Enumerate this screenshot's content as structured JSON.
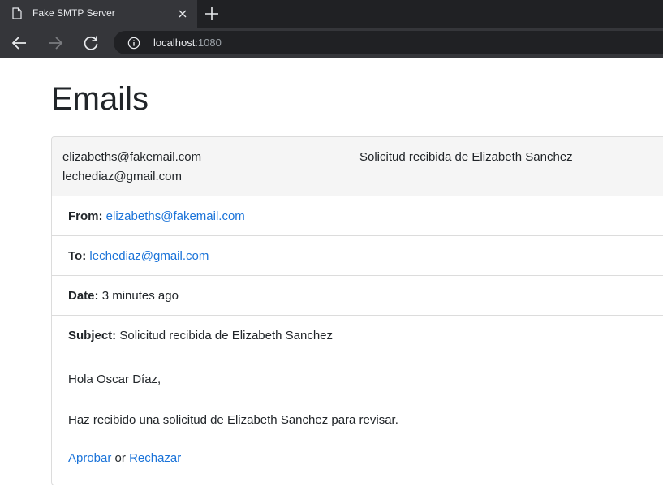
{
  "browser": {
    "tab_title": "Fake SMTP Server",
    "url_host": "localhost",
    "url_port": ":1080"
  },
  "page": {
    "title": "Emails"
  },
  "email": {
    "header": {
      "from": "elizabeths@fakemail.com",
      "to": "lechediaz@gmail.com",
      "subject": "Solicitud recibida de Elizabeth Sanchez"
    },
    "from_label": "From:",
    "from_value": "elizabeths@fakemail.com",
    "to_label": "To:",
    "to_value": "lechediaz@gmail.com",
    "date_label": "Date:",
    "date_value": "3 minutes ago",
    "subject_label": "Subject:",
    "subject_value": "Solicitud recibida de Elizabeth Sanchez",
    "body": {
      "greeting": "Hola Oscar Díaz,",
      "message": "Haz recibido una solicitud de Elizabeth Sanchez para revisar.",
      "approve_link": "Aprobar",
      "connector": "or",
      "reject_link": "Rechazar"
    }
  }
}
